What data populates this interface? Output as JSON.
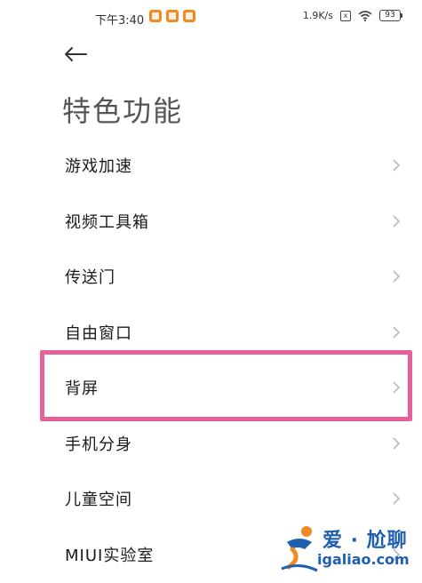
{
  "status_bar": {
    "time": "下午3:40",
    "net_speed": "1.9K/s",
    "sim_label": "x",
    "battery": "93",
    "notification_colors": [
      "#f08a24",
      "#f08a24",
      "#f08a24"
    ]
  },
  "header": {
    "title": "特色功能"
  },
  "menu": {
    "items": [
      {
        "label": "游戏加速"
      },
      {
        "label": "视频工具箱"
      },
      {
        "label": "传送门"
      },
      {
        "label": "自由窗口"
      },
      {
        "label": "背屏"
      },
      {
        "label": "手机分身"
      },
      {
        "label": "儿童空间"
      },
      {
        "label": "MIUI实验室"
      }
    ]
  },
  "highlight": {
    "color": "#e8609a",
    "target": "背屏"
  },
  "watermark": {
    "brand": "爱 · 尬聊",
    "url": "igaliao.com"
  }
}
